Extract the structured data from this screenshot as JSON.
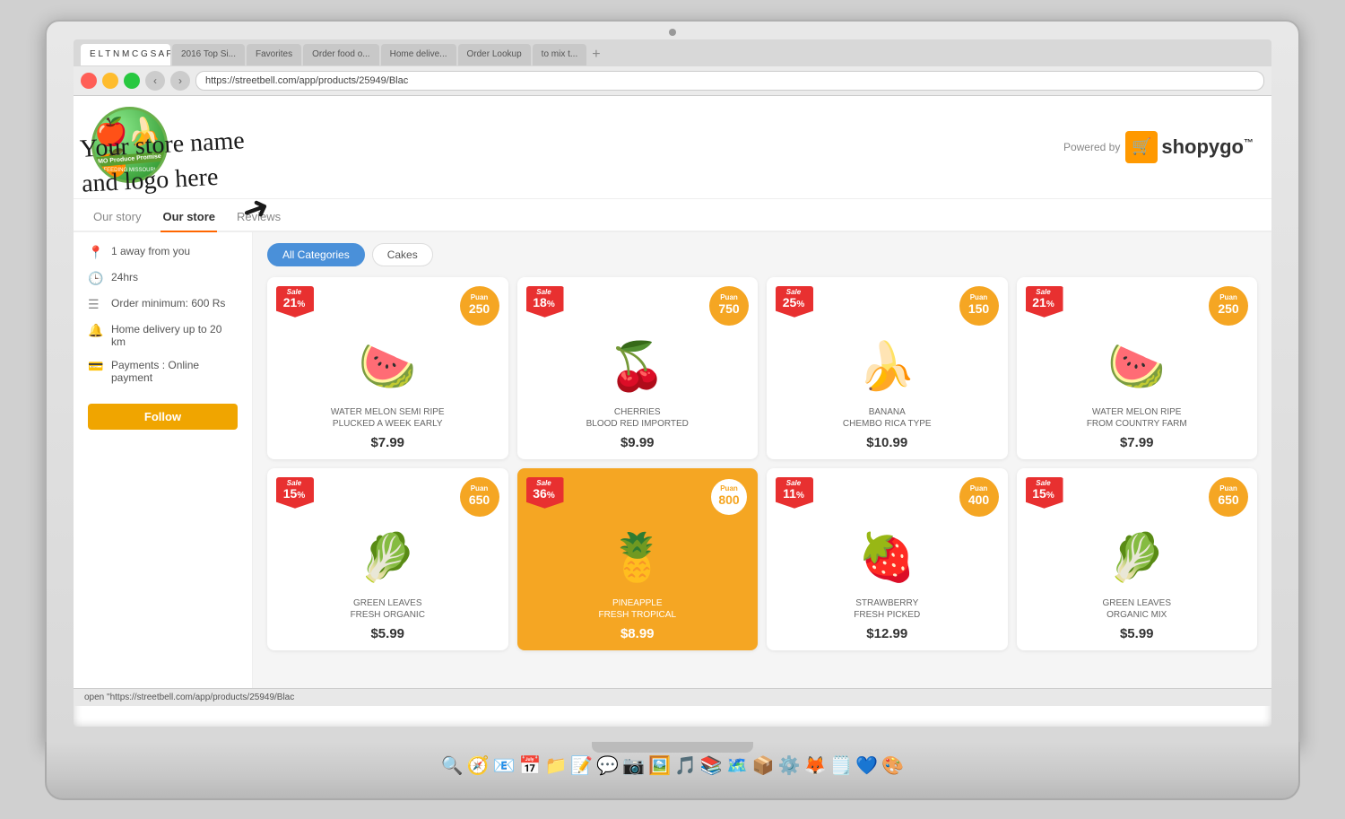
{
  "laptop": {
    "annotation_line1": "Your store name",
    "annotation_line2": "and logo here"
  },
  "browser": {
    "tabs": [
      {
        "label": "E L T N M C G S A F D W B S S",
        "active": false
      },
      {
        "label": "2016 Top Si...",
        "active": false
      },
      {
        "label": "Favorites",
        "active": false
      },
      {
        "label": "Order food o...",
        "active": false
      },
      {
        "label": "Home delive...",
        "active": true
      },
      {
        "label": "Order Lookup",
        "active": false
      },
      {
        "label": "to mix t...",
        "active": false
      }
    ],
    "url": "https://streetbell.com/app/products/25949/Blac",
    "bookmarks": [
      "2016 Top Si...",
      "Favorites",
      "Order food o...",
      "Home delive...",
      "Order Lookup",
      "to mix t..."
    ]
  },
  "store": {
    "logo_fruits": "🍎🍌🍊",
    "logo_banner": "MO Produce Promise",
    "logo_sub": "FEEDING MISSOURI",
    "powered_by": "Powered by",
    "brand_name": "shopygo",
    "brand_tm": "™"
  },
  "nav_tabs": [
    {
      "label": "Our story",
      "active": false
    },
    {
      "label": "Our store",
      "active": true
    },
    {
      "label": "Reviews",
      "active": false
    }
  ],
  "sidebar": {
    "items": [
      {
        "icon": "📍",
        "text": "1  away from you"
      },
      {
        "icon": "🕒",
        "text": "24hrs"
      },
      {
        "icon": "☰",
        "text": "Order minimum: 600 Rs"
      },
      {
        "icon": "🔔",
        "text": "Home delivery up to 20 km"
      },
      {
        "icon": "💳",
        "text": "Payments : Online payment"
      }
    ],
    "follow_label": "Follow"
  },
  "filters": [
    {
      "label": "All Categories",
      "active": true
    },
    {
      "label": "Cakes",
      "active": false
    }
  ],
  "products": [
    {
      "sale_pct": "21",
      "puan": "250",
      "emoji": "🍉",
      "name": "WATER MELON SEMI RIPE\nPLUCKED A WEEK EARLY",
      "price": "$7.99",
      "highlighted": false
    },
    {
      "sale_pct": "18",
      "puan": "750",
      "emoji": "🍒",
      "name": "CHERRIES\nBLOOD RED IMPORTED",
      "price": "$9.99",
      "highlighted": false
    },
    {
      "sale_pct": "25",
      "puan": "150",
      "emoji": "🍌",
      "name": "BANANA\nCHEMBO RICA TYPE",
      "price": "$10.99",
      "highlighted": false
    },
    {
      "sale_pct": "21",
      "puan": "250",
      "emoji": "🍉",
      "name": "WATER MELON RIPE\nFROM COUNTRY FARM",
      "price": "$7.99",
      "highlighted": false
    },
    {
      "sale_pct": "15",
      "puan": "650",
      "emoji": "🥬",
      "name": "GREEN LEAVES\nFRESH ORGANIC",
      "price": "$5.99",
      "highlighted": false
    },
    {
      "sale_pct": "36",
      "puan": "800",
      "emoji": "🍍",
      "name": "PINEAPPLE\nFRESH TROPICAL",
      "price": "$8.99",
      "highlighted": true
    },
    {
      "sale_pct": "11",
      "puan": "400",
      "emoji": "🍓",
      "name": "STRAWBERRY\nFRESH PICKED",
      "price": "$12.99",
      "highlighted": false
    },
    {
      "sale_pct": "15",
      "puan": "650",
      "emoji": "🥬",
      "name": "GREEN LEAVES\nORGANIC MIX",
      "price": "$5.99",
      "highlighted": false
    }
  ],
  "status_bar": {
    "text": "open \"https://streetbell.com/app/products/25949/Blac"
  }
}
